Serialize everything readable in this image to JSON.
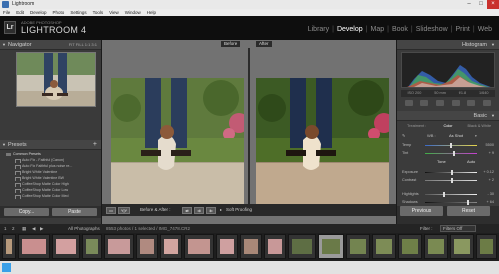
{
  "window": {
    "title": "Lightroom",
    "controls": [
      "–",
      "□",
      "×"
    ]
  },
  "menu": [
    "File",
    "Edit",
    "Develop",
    "Photo",
    "Settings",
    "Tools",
    "View",
    "Window",
    "Help"
  ],
  "identity": {
    "badge": "Lr",
    "subtitle": "ADOBE PHOTOSHOP",
    "title": "LIGHTROOM 4"
  },
  "modules": [
    {
      "label": "Library",
      "active": false
    },
    {
      "label": "Develop",
      "active": true
    },
    {
      "label": "Map",
      "active": false
    },
    {
      "label": "Book",
      "active": false
    },
    {
      "label": "Slideshow",
      "active": false
    },
    {
      "label": "Print",
      "active": false
    },
    {
      "label": "Web",
      "active": false
    }
  ],
  "navigator": {
    "header": "Navigator",
    "zoom_options": "FIT  FILL  1:1  3:1"
  },
  "presets": {
    "header": "Presets",
    "rows": [
      {
        "label": "Common Presets",
        "folder": true
      },
      {
        "label": "Auto Fix - Faithful (Canon)",
        "folder": false
      },
      {
        "label": "Auto Fix Faithful plus noise re...",
        "folder": false
      },
      {
        "label": "Bright White Valentine",
        "folder": false
      },
      {
        "label": "Bright White Valentine BW",
        "folder": false
      },
      {
        "label": "CoffeeShop Matte Color High",
        "folder": false
      },
      {
        "label": "CoffeeShop Matte Color Low",
        "folder": false
      },
      {
        "label": "CoffeeShop Matte Color Med",
        "folder": false
      }
    ]
  },
  "left_buttons": {
    "copy": "Copy...",
    "paste": "Paste"
  },
  "main": {
    "before_label": "Before",
    "after_label": "After"
  },
  "toolbar": {
    "view_icon_1": "▭",
    "view_icon_2": "Y|Y",
    "before_after": "Before & After :",
    "soft_proofing": "Soft Proofing"
  },
  "histogram": {
    "header": "Histogram",
    "meta": [
      "ISO 200",
      "50 mm",
      "f/1.8",
      "1/640"
    ]
  },
  "basic": {
    "header": "Basic",
    "treatment_label": "Treatment :",
    "treatment_tabs": [
      {
        "label": "Color",
        "active": true
      },
      {
        "label": "Black & White",
        "active": false
      }
    ],
    "wb_label": "WB :",
    "wb_value": "As Shot",
    "tone_label": "Tone",
    "auto_label": "Auto",
    "sliders": [
      {
        "name": "Temp",
        "value": "5500",
        "position": 0.5
      },
      {
        "name": "Tint",
        "value": "+ 9",
        "position": 0.55
      },
      {
        "name": "Exposure",
        "value": "+ 0.12",
        "position": 0.52
      },
      {
        "name": "Contrast",
        "value": "+ 2",
        "position": 0.51
      },
      {
        "name": "Highlights",
        "value": "- 30",
        "position": 0.35
      },
      {
        "name": "Shadows",
        "value": "+ 64",
        "position": 0.82
      }
    ]
  },
  "right_buttons": {
    "previous": "Previous",
    "reset": "Reset"
  },
  "filmstrip_bar": {
    "grid_numbers": [
      "1",
      "2"
    ],
    "source": "All Photographs",
    "info": "8553 photos / 1 selected / IMG_7478.CR2",
    "filter_label": "Filter :",
    "filter_value": "Filters Off"
  },
  "colors": {
    "accent": "#ffffff",
    "panel": "#3a3a3a",
    "background": "#727272"
  }
}
